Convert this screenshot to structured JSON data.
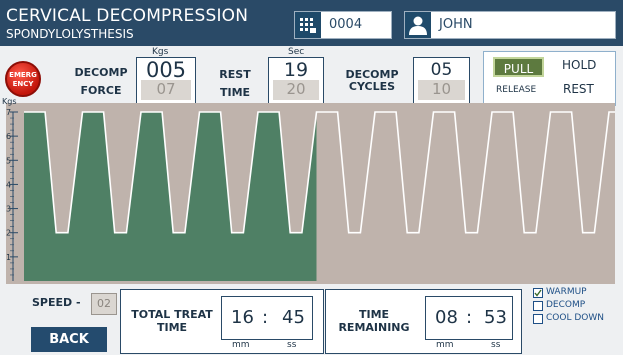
{
  "header": {
    "title": "CERVICAL DECOMPRESSION",
    "subtitle": "SPONDYLOLYSTHESIS",
    "patient_id": "0004",
    "patient_name": "JOHN",
    "patient_id_icon": "keypad-icon",
    "patient_name_icon": "user-icon"
  },
  "emergency": {
    "label_line1": "EMERG",
    "label_line2": "ENCY"
  },
  "decomp_force": {
    "label_line1": "DECOMP",
    "label_line2": "FORCE",
    "unit": "Kgs",
    "set_value": "005",
    "actual_value": "07"
  },
  "rest_time": {
    "label_line1": "REST",
    "label_line2": "TIME",
    "unit": "Sec",
    "set_value": "19",
    "actual_value": "20"
  },
  "decomp_cycles": {
    "label_line1": "DECOMP",
    "label_line2": "CYCLES",
    "set_value": "05",
    "actual_value": "10"
  },
  "mode": {
    "pull_label": "PULL",
    "hold_label": "HOLD",
    "release_label": "RELEASE",
    "rest_label": "REST",
    "active": "PULL"
  },
  "chart_data": {
    "type": "area",
    "ylabel": "Kgs",
    "ylim": [
      0,
      7
    ],
    "y_ticks": [
      "1",
      "2",
      "3",
      "4",
      "5",
      "6",
      "7"
    ],
    "profile": "repeating trapezoidal pull/rest cycles",
    "cycles_total": 10,
    "cycles_completed": 5,
    "pull_level": 7,
    "rest_level": 2,
    "completed_color": "#4f8065",
    "background_color": "#bfb3ac",
    "line_color": "#ffffff"
  },
  "speed": {
    "label": "SPEED -",
    "value": "02"
  },
  "back_button": {
    "label": "BACK"
  },
  "total_treat_time": {
    "label_line1": "TOTAL TREAT",
    "label_line2": "TIME",
    "minutes": "16",
    "seconds": "45",
    "sep": ":",
    "min_unit": "mm",
    "sec_unit": "ss"
  },
  "time_remaining": {
    "label_line1": "TIME",
    "label_line2": "REMAINING",
    "minutes": "08",
    "seconds": "53",
    "sep": ":",
    "min_unit": "mm",
    "sec_unit": "ss"
  },
  "phase_legend": [
    {
      "label": "WARMUP",
      "checked": true
    },
    {
      "label": "DECOMP",
      "checked": false
    },
    {
      "label": "COOL DOWN",
      "checked": false
    }
  ],
  "colors": {
    "header": "#2a4a67",
    "accent_green": "#5d7a3f",
    "emergency_red": "#d0201a"
  }
}
